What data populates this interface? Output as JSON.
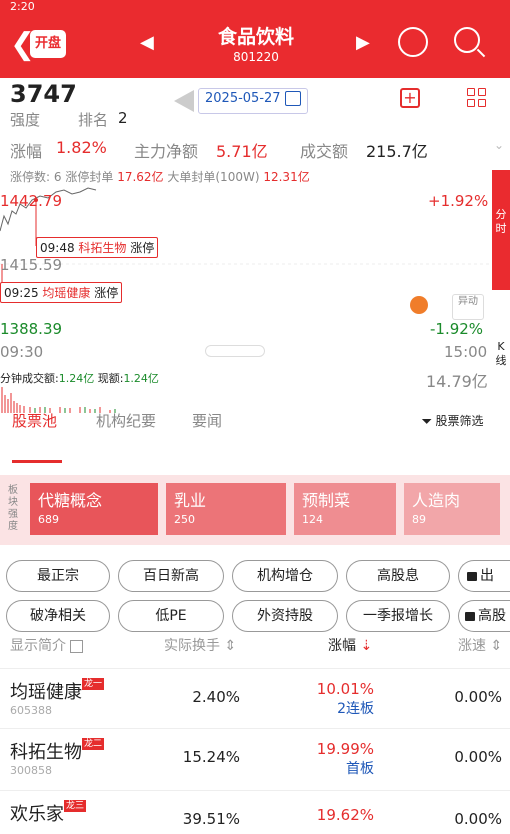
{
  "status_time": "2:20",
  "header": {
    "back_icon": "chevron-left-icon",
    "kaipan_label": "开盘",
    "title": "食品饮料",
    "subcode": "801220"
  },
  "info": {
    "strength_value": "3747",
    "strength_label": "强度",
    "rank_label": "排名",
    "rank_value": "2",
    "date": "2025-05-27",
    "change_label": "涨幅",
    "change_value": "1.82%",
    "netflow_label": "主力净额",
    "netflow_value": "5.71亿",
    "turnover_label": "成交额",
    "turnover_value": "215.7亿"
  },
  "limit_info": {
    "count_label": "涨停数:",
    "count": "6",
    "seal_label": "涨停封单",
    "seal_value": "17.62亿",
    "bigorder_label": "大单封单(100W)",
    "bigorder_value": "12.31亿"
  },
  "chart": {
    "price_high": "1442.79",
    "price_mid": "1415.59",
    "price_low": "1388.39",
    "pct_high": "+1.92%",
    "pct_low": "-1.92%",
    "time_start": "09:30",
    "time_end": "15:00",
    "tag1_time": "09:48",
    "tag1_name": "科拓生物",
    "tag1_status": "涨停",
    "tag2_time": "09:25",
    "tag2_name": "均瑶健康",
    "tag2_status": "涨停",
    "minute_vol_label": "分钟成交额:",
    "minute_vol_value": "1.24亿",
    "current_vol_label": "现额:",
    "current_vol_value": "1.24亿",
    "total_vol": "14.79亿",
    "yidong_label": "异动",
    "side_tab1": "分时",
    "side_tab2": "K线"
  },
  "tabs": [
    "股票池",
    "机构纪要",
    "要闻"
  ],
  "filter_label": "股票筛选",
  "concepts_label": "板块强度",
  "concepts": [
    {
      "name": "代糖概念",
      "count": "689"
    },
    {
      "name": "乳业",
      "count": "250"
    },
    {
      "name": "预制菜",
      "count": "124"
    },
    {
      "name": "人造肉",
      "count": "89"
    }
  ],
  "chips_row1": [
    "最正宗",
    "百日新高",
    "机构增仓",
    "高股息",
    "出"
  ],
  "chips_row2": [
    "破净相关",
    "低PE",
    "外资持股",
    "一季报增长",
    "高股"
  ],
  "table_headers": {
    "col1": "显示简介",
    "col2": "实际换手",
    "col3": "涨幅",
    "col4": "涨速"
  },
  "rows": [
    {
      "name": "均瑶健康",
      "badge": "龙一",
      "code": "605388",
      "turnover": "2.40%",
      "change": "10.01%",
      "sub": "2连板",
      "speed": "0.00%"
    },
    {
      "name": "科拓生物",
      "badge": "龙二",
      "code": "300858",
      "turnover": "15.24%",
      "change": "19.99%",
      "sub": "首板",
      "speed": "0.00%"
    },
    {
      "name": "欢乐家",
      "badge": "龙三",
      "code": "",
      "turnover": "39.51%",
      "change": "19.62%",
      "sub": "",
      "speed": "0.00%"
    }
  ]
}
